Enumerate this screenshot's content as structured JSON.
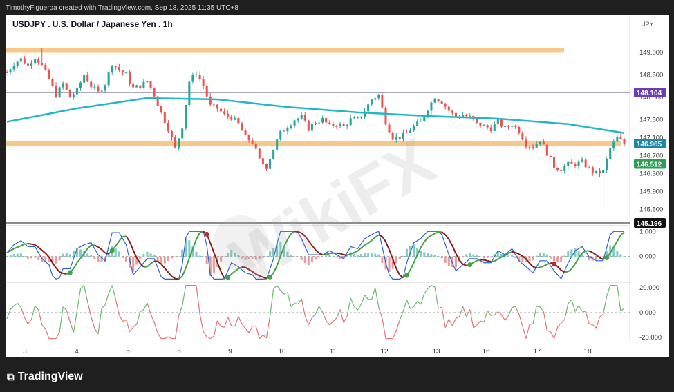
{
  "header": {
    "credit": "TimothyFigueroa created with TradingView.com, Sep 18, 2025 11:35 UTC+8"
  },
  "footer": {
    "brand": "TradingView",
    "logo_icon": "tradingview-logo-icon"
  },
  "watermark": {
    "text": "WikiFX",
    "icon": "wikifx-eagle-logo-icon"
  },
  "chart_data": {
    "type": "candlestick",
    "title": "USDJPY . U.S. Dollar / Japanese Yen . 1h",
    "currency_label": "JPY",
    "x_tick_labels": [
      "3",
      "4",
      "5",
      "6",
      "9",
      "10",
      "11",
      "12",
      "13",
      "16",
      "17",
      "18"
    ],
    "price_axis": {
      "ylim": [
        145.15,
        149.55
      ],
      "ticks": [
        "149.000",
        "148.500",
        "148.000",
        "147.500",
        "147.100",
        "146.700",
        "146.300",
        "145.900",
        "145.500"
      ],
      "tick_values": [
        149.0,
        148.5,
        148.0,
        147.5,
        147.1,
        146.7,
        146.3,
        145.9,
        145.5
      ]
    },
    "price_path": [
      [
        0,
        148.55
      ],
      [
        2,
        148.75
      ],
      [
        4,
        148.85
      ],
      [
        6,
        148.7
      ],
      [
        8,
        148.9
      ],
      [
        10,
        148.7
      ],
      [
        12,
        148.4
      ],
      [
        14,
        148.05
      ],
      [
        16,
        148.3
      ],
      [
        18,
        148.0
      ],
      [
        20,
        148.15
      ],
      [
        22,
        148.5
      ],
      [
        24,
        148.25
      ],
      [
        26,
        148.1
      ],
      [
        28,
        148.3
      ],
      [
        30,
        148.75
      ],
      [
        32,
        148.6
      ],
      [
        34,
        148.5
      ],
      [
        36,
        148.2
      ],
      [
        38,
        148.25
      ],
      [
        40,
        148.35
      ],
      [
        42,
        148.05
      ],
      [
        44,
        147.65
      ],
      [
        46,
        147.3
      ],
      [
        48,
        146.85
      ],
      [
        50,
        147.35
      ],
      [
        52,
        148.35
      ],
      [
        54,
        148.55
      ],
      [
        56,
        148.25
      ],
      [
        58,
        147.8
      ],
      [
        60,
        147.75
      ],
      [
        62,
        147.6
      ],
      [
        64,
        147.55
      ],
      [
        66,
        147.4
      ],
      [
        68,
        147.1
      ],
      [
        70,
        147.0
      ],
      [
        72,
        146.6
      ],
      [
        74,
        146.45
      ],
      [
        76,
        146.85
      ],
      [
        78,
        147.2
      ],
      [
        80,
        147.35
      ],
      [
        82,
        147.5
      ],
      [
        84,
        147.55
      ],
      [
        86,
        147.3
      ],
      [
        88,
        147.45
      ],
      [
        90,
        147.5
      ],
      [
        92,
        147.35
      ],
      [
        94,
        147.4
      ],
      [
        96,
        147.35
      ],
      [
        98,
        147.5
      ],
      [
        100,
        147.5
      ],
      [
        102,
        147.7
      ],
      [
        104,
        147.95
      ],
      [
        106,
        148.05
      ],
      [
        108,
        147.45
      ],
      [
        110,
        147.1
      ],
      [
        112,
        147.1
      ],
      [
        114,
        147.2
      ],
      [
        116,
        147.35
      ],
      [
        118,
        147.45
      ],
      [
        120,
        147.75
      ],
      [
        122,
        148.0
      ],
      [
        124,
        147.9
      ],
      [
        126,
        147.7
      ],
      [
        128,
        147.55
      ],
      [
        130,
        147.6
      ],
      [
        132,
        147.55
      ],
      [
        134,
        147.4
      ],
      [
        136,
        147.35
      ],
      [
        138,
        147.3
      ],
      [
        140,
        147.45
      ],
      [
        142,
        147.3
      ],
      [
        144,
        147.4
      ],
      [
        146,
        147.25
      ],
      [
        148,
        146.95
      ],
      [
        150,
        146.9
      ],
      [
        152,
        147.05
      ],
      [
        154,
        146.75
      ],
      [
        156,
        146.45
      ],
      [
        158,
        146.4
      ],
      [
        160,
        146.5
      ],
      [
        162,
        146.5
      ],
      [
        164,
        146.55
      ],
      [
        166,
        146.4
      ],
      [
        168,
        146.3
      ],
      [
        170,
        146.35
      ],
      [
        172,
        146.85
      ],
      [
        174,
        147.1
      ],
      [
        176,
        146.95
      ]
    ],
    "wick_extremes": [
      {
        "label": "9 low",
        "value": 146.35
      },
      {
        "label": "18 spike low",
        "value": 145.55
      },
      {
        "label": "3 high",
        "value": 149.1
      }
    ],
    "moving_average": {
      "name": "",
      "color": "#1fb8c6",
      "path": [
        [
          0,
          147.45
        ],
        [
          20,
          147.75
        ],
        [
          40,
          147.98
        ],
        [
          60,
          147.95
        ],
        [
          80,
          147.78
        ],
        [
          100,
          147.66
        ],
        [
          120,
          147.58
        ],
        [
          140,
          147.52
        ],
        [
          160,
          147.4
        ],
        [
          176,
          147.2
        ]
      ]
    },
    "horizontal_levels": [
      {
        "kind": "zone",
        "value": 149.05,
        "color": "#f5b461"
      },
      {
        "kind": "zone",
        "value": 146.965,
        "color": "#f5b461"
      },
      {
        "kind": "line",
        "value": 148.104,
        "color": "#5c4a8c"
      },
      {
        "kind": "line",
        "value": 146.512,
        "color": "#43a047"
      },
      {
        "kind": "line",
        "value": 145.196,
        "color": "#1a1a1a"
      }
    ],
    "price_labels": [
      {
        "text": "148.104",
        "value": 148.104,
        "color": "#6a3fb5"
      },
      {
        "text": "146.965",
        "value": 146.965,
        "color": "#1e88a8"
      },
      {
        "text": "146.512",
        "value": 146.512,
        "color": "#2e9d55"
      },
      {
        "text": "145.196",
        "value": 145.196,
        "color": "#111111"
      }
    ],
    "oscillator_1": {
      "ticks": [
        "1.000",
        "0.000"
      ],
      "tick_values": [
        1.0,
        0.0
      ],
      "ylim": [
        -1.0,
        1.2
      ]
    },
    "oscillator_2": {
      "ticks": [
        "20.000",
        "0.000",
        "-20.000"
      ],
      "tick_values": [
        20,
        0,
        -20
      ],
      "ylim": [
        -24,
        24
      ]
    },
    "colors": {
      "up": "#26a69a",
      "down": "#ef5350",
      "macd_fast": "#2a62d9",
      "macd_slow_up": "#43a047",
      "macd_slow_down": "#8b1a1a",
      "osc_up": "#66bb6a",
      "osc_down": "#e57373",
      "grid": "#eeeeee"
    }
  }
}
